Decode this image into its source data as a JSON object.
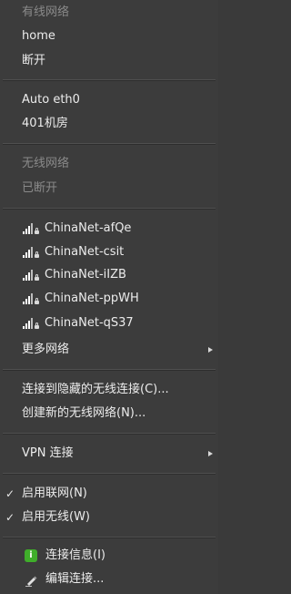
{
  "wired": {
    "header": "有线网络",
    "connection": "home",
    "disconnect": "断开"
  },
  "ethernet": {
    "name": "Auto eth0",
    "room": "401机房"
  },
  "wireless": {
    "header": "无线网络",
    "status": "已断开",
    "networks": [
      {
        "ssid": "ChinaNet-afQe"
      },
      {
        "ssid": "ChinaNet-csit"
      },
      {
        "ssid": "ChinaNet-iIZB"
      },
      {
        "ssid": "ChinaNet-ppWH"
      },
      {
        "ssid": "ChinaNet-qS37"
      }
    ],
    "more": "更多网络"
  },
  "hidden": {
    "connect": "连接到隐藏的无线连接(C)...",
    "create": "创建新的无线网络(N)..."
  },
  "vpn": {
    "label": "VPN 连接"
  },
  "toggles": {
    "networking": "启用联网(N)",
    "wireless": "启用无线(W)",
    "check_mark": "✓"
  },
  "footer": {
    "info": "连接信息(I)",
    "edit": "编辑连接..."
  },
  "icons": {
    "signal": "wifi-signal-locked-icon",
    "info": "info-icon",
    "edit": "edit-pencil-icon"
  }
}
